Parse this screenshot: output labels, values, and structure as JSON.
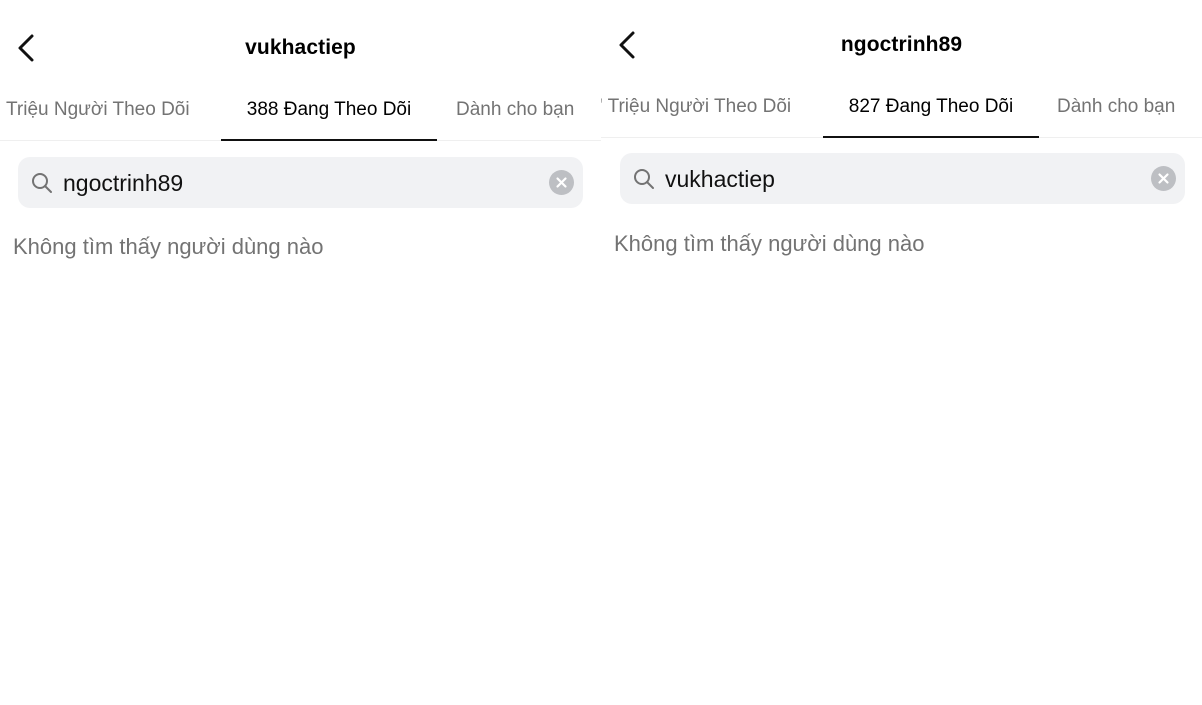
{
  "screens": [
    {
      "title": "vukhactiep",
      "tabs": [
        "Triệu Người Theo Dõi",
        "388 Đang Theo Dõi",
        "Dành cho bạn"
      ],
      "search_value": "ngoctrinh89",
      "empty_message": "Không tìm thấy người dùng nào"
    },
    {
      "title": "ngoctrinh89",
      "tabs": [
        "' Triệu Người Theo Dõi",
        "827 Đang Theo Dõi",
        "Dành cho bạn"
      ],
      "search_value": "vukhactiep",
      "empty_message": "Không tìm thấy người dùng nào"
    }
  ],
  "icons": {
    "back": "chevron-left-icon",
    "search": "search-icon",
    "clear": "clear-icon"
  },
  "colors": {
    "background": "#ffffff",
    "search_bg": "#f1f2f4",
    "muted_text": "#737373",
    "active_tab_text": "#000000",
    "clear_icon_bg": "#bdbfc3"
  }
}
